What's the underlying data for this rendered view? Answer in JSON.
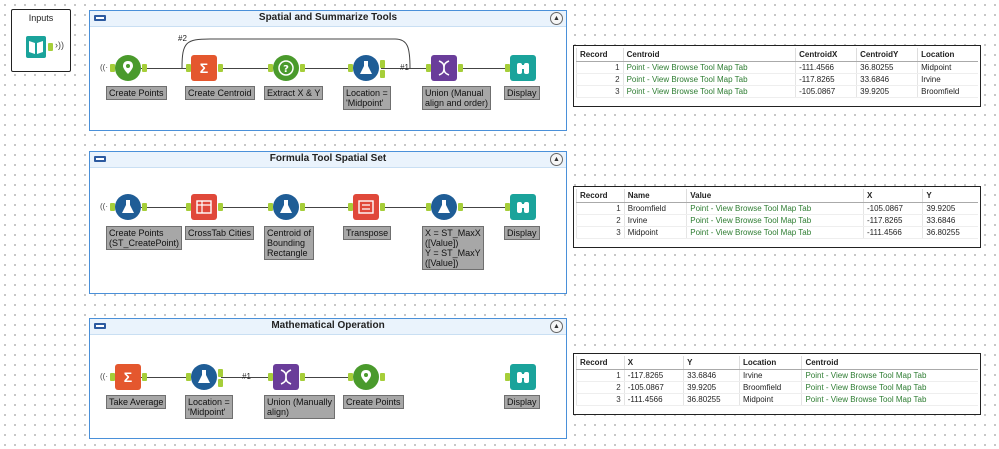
{
  "inputs": {
    "title": "Inputs"
  },
  "containers": [
    {
      "title": "Spatial and Summarize Tools",
      "tools": [
        {
          "label": "Create Points",
          "icon": "create-points-icon"
        },
        {
          "label": "Create Centroid",
          "icon": "summarize-icon"
        },
        {
          "label": "Extract X & Y",
          "icon": "formula-question-icon"
        },
        {
          "label": "Location =\n'Midpoint'",
          "icon": "filter-flask-icon"
        },
        {
          "label": "Union (Manual\nalign and order)",
          "icon": "union-dna-icon"
        },
        {
          "label": "Display",
          "icon": "browse-binoculars-icon"
        }
      ],
      "connections": [
        "#2",
        "#1"
      ]
    },
    {
      "title": "Formula Tool Spatial Set",
      "tools": [
        {
          "label": "Create Points\n(ST_CreatePoint)",
          "icon": "formula-flask-icon"
        },
        {
          "label": "CrossTab Cities",
          "icon": "crosstab-icon"
        },
        {
          "label": "Centroid of\nBounding\nRectangle",
          "icon": "formula-flask-icon"
        },
        {
          "label": "Transpose",
          "icon": "transpose-icon"
        },
        {
          "label": "X = ST_MaxX\n([Value])\nY = ST_MaxY\n([Value])",
          "icon": "formula-flask-icon"
        },
        {
          "label": "Display",
          "icon": "browse-binoculars-icon"
        }
      ]
    },
    {
      "title": "Mathematical Operation",
      "tools": [
        {
          "label": "Take Average",
          "icon": "summarize-icon"
        },
        {
          "label": "Location =\n'Midpoint'",
          "icon": "filter-flask-icon"
        },
        {
          "label": "Union (Manually\nalign)",
          "icon": "union-dna-icon"
        },
        {
          "label": "Create Points",
          "icon": "create-points-icon"
        },
        {
          "label": "Display",
          "icon": "browse-binoculars-icon"
        }
      ],
      "connections": [
        "#1"
      ]
    }
  ],
  "results": [
    {
      "columns": [
        "Record",
        "Centroid",
        "CentroidX",
        "CentroidY",
        "Location"
      ],
      "rows": [
        [
          "1",
          "Point - View Browse Tool Map Tab",
          "-111.4566",
          "36.80255",
          "Midpoint"
        ],
        [
          "2",
          "Point - View Browse Tool Map Tab",
          "-117.8265",
          "33.6846",
          "Irvine"
        ],
        [
          "3",
          "Point - View Browse Tool Map Tab",
          "-105.0867",
          "39.9205",
          "Broomfield"
        ]
      ]
    },
    {
      "columns": [
        "Record",
        "Name",
        "Value",
        "X",
        "Y"
      ],
      "rows": [
        [
          "1",
          "Broomfield",
          "Point - View Browse Tool Map Tab",
          "-105.0867",
          "39.9205"
        ],
        [
          "2",
          "Irvine",
          "Point - View Browse Tool Map Tab",
          "-117.8265",
          "33.6846"
        ],
        [
          "3",
          "Midpoint",
          "Point - View Browse Tool Map Tab",
          "-111.4566",
          "36.80255"
        ]
      ]
    },
    {
      "columns": [
        "Record",
        "X",
        "Y",
        "Location",
        "Centroid"
      ],
      "rows": [
        [
          "1",
          "-117.8265",
          "33.6846",
          "Irvine",
          "Point - View Browse Tool Map Tab"
        ],
        [
          "2",
          "-105.0867",
          "39.9205",
          "Broomfield",
          "Point - View Browse Tool Map Tab"
        ],
        [
          "3",
          "-111.4566",
          "36.80255",
          "Midpoint",
          "Point - View Browse Tool Map Tab"
        ]
      ]
    }
  ],
  "colors": {
    "container_border": "#4a90d9",
    "anchor": "#a6ce39",
    "spatial_green": "#4a9a2c",
    "summarize_orange": "#e4572e",
    "formula_blue": "#1f5d96",
    "union_purple": "#6a3d9a",
    "browse_teal": "#1aa39b",
    "transpose_red": "#e0483a",
    "label_gray": "#a7a7a7"
  }
}
